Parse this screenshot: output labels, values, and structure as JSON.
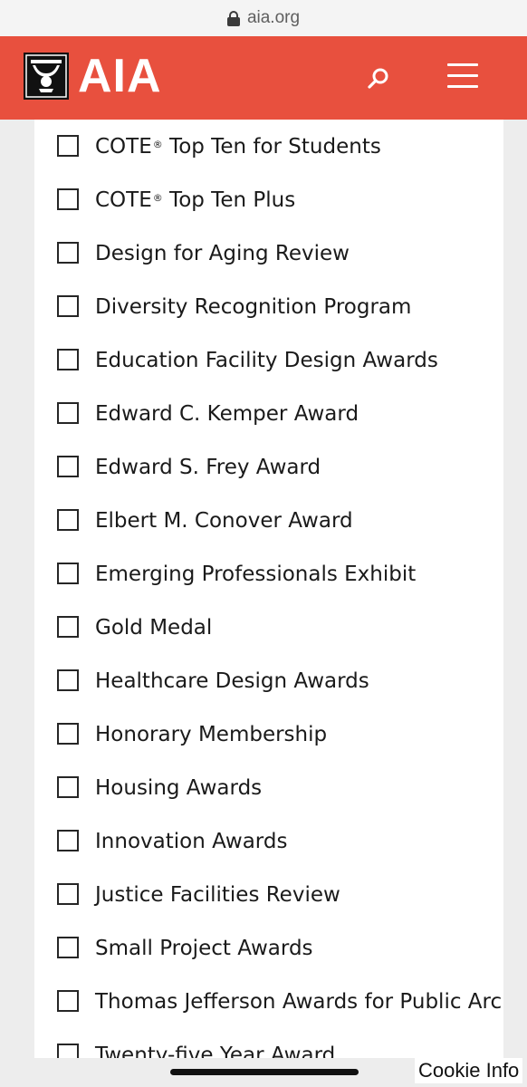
{
  "browser": {
    "url": "aia.org"
  },
  "header": {
    "logo_text": "AIA",
    "brand_color": "#e8503e"
  },
  "filters": [
    {
      "label": "COTE",
      "sup": "®",
      "suffix": " Top Ten for Students",
      "checked": false
    },
    {
      "label": "COTE",
      "sup": "®",
      "suffix": " Top Ten Plus",
      "checked": false
    },
    {
      "label": "Design for Aging Review",
      "checked": false
    },
    {
      "label": "Diversity Recognition Program",
      "checked": false
    },
    {
      "label": "Education Facility Design Awards",
      "checked": false
    },
    {
      "label": "Edward C. Kemper Award",
      "checked": false
    },
    {
      "label": "Edward S. Frey Award",
      "checked": false
    },
    {
      "label": "Elbert M. Conover Award",
      "checked": false
    },
    {
      "label": "Emerging Professionals Exhibit",
      "checked": false
    },
    {
      "label": "Gold Medal",
      "checked": false
    },
    {
      "label": "Healthcare Design Awards",
      "checked": false
    },
    {
      "label": "Honorary Membership",
      "checked": false
    },
    {
      "label": "Housing Awards",
      "checked": false
    },
    {
      "label": "Innovation Awards",
      "checked": false
    },
    {
      "label": "Justice Facilities Review",
      "checked": false
    },
    {
      "label": "Small Project Awards",
      "checked": false
    },
    {
      "label": "Thomas Jefferson Awards for Public Architecture",
      "checked": false
    },
    {
      "label": "Twenty-five Year Award",
      "checked": false
    }
  ],
  "cookie": {
    "label": "Cookie Info"
  },
  "icons": {
    "lock": "lock-icon",
    "search": "search-icon",
    "menu": "hamburger-menu-icon",
    "logo": "aia-logo-mark"
  }
}
